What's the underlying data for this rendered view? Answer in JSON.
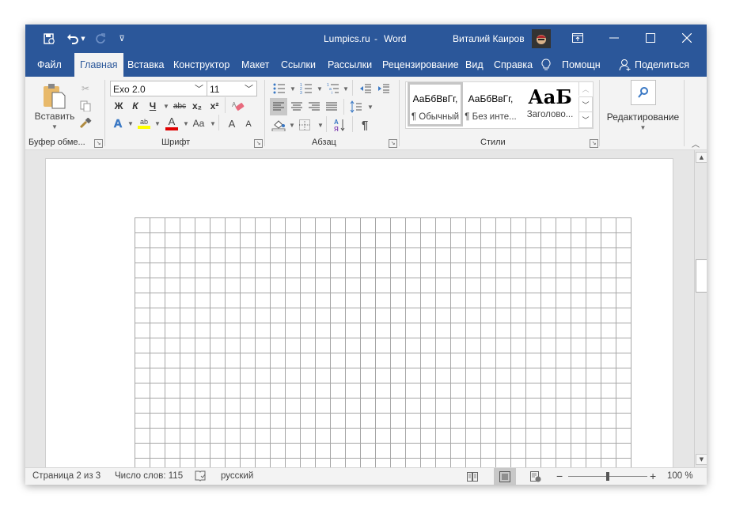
{
  "window": {
    "title_doc": "Lumpics.ru",
    "title_sep": "-",
    "title_app": "Word",
    "user_name": "Виталий Каиров"
  },
  "quick_access": {
    "save_icon": "autosave-icon",
    "undo_icon": "undo-icon",
    "redo_icon": "redo-icon",
    "customize_icon": "customize-qat-icon"
  },
  "window_controls": {
    "ribbon_display": "ribbon-display-options-icon",
    "minimize": "minimize-icon",
    "maximize": "maximize-icon",
    "close": "close-icon"
  },
  "tabs": [
    {
      "label": "Файл",
      "active": false
    },
    {
      "label": "Главная",
      "active": true
    },
    {
      "label": "Вставка",
      "active": false
    },
    {
      "label": "Конструктор",
      "active": false
    },
    {
      "label": "Макет",
      "active": false
    },
    {
      "label": "Ссылки",
      "active": false
    },
    {
      "label": "Рассылки",
      "active": false
    },
    {
      "label": "Рецензирование",
      "active": false
    },
    {
      "label": "Вид",
      "active": false
    },
    {
      "label": "Справка",
      "active": false
    }
  ],
  "tell_me": {
    "label": "Помощн"
  },
  "share": {
    "label": "Поделиться"
  },
  "ribbon": {
    "clipboard": {
      "label": "Буфер обме...",
      "paste_label": "Вставить"
    },
    "font": {
      "label": "Шрифт",
      "font_name": "Exo 2.0",
      "font_size": "11",
      "bold": "Ж",
      "italic": "К",
      "underline": "Ч",
      "strikethrough": "abc",
      "subscript": "x₂",
      "superscript": "x²",
      "text_effects": "A",
      "highlight": "ab",
      "font_color": "A",
      "change_case": "Aa",
      "grow_font": "A",
      "shrink_font": "A",
      "highlight_color": "#ffff00",
      "font_color_value": "#e00000"
    },
    "paragraph": {
      "label": "Абзац",
      "sort_label": "А Я",
      "show_marks": "¶"
    },
    "styles": {
      "label": "Стили",
      "items": [
        {
          "preview": "АаБбВвГг,",
          "name": "¶ Обычный",
          "selected": true
        },
        {
          "preview": "АаБбВвГг,",
          "name": "¶ Без инте...",
          "selected": false
        },
        {
          "preview": "АаБ",
          "name": "Заголово...",
          "selected": false
        }
      ]
    },
    "editing": {
      "label": "Редактирование"
    }
  },
  "grid": {
    "columns": 33,
    "rows": 17
  },
  "status": {
    "page": "Страница 2 из 3",
    "words": "Число слов: 115",
    "language": "русский",
    "zoom_percent": "100 %",
    "zoom_value": 100
  }
}
